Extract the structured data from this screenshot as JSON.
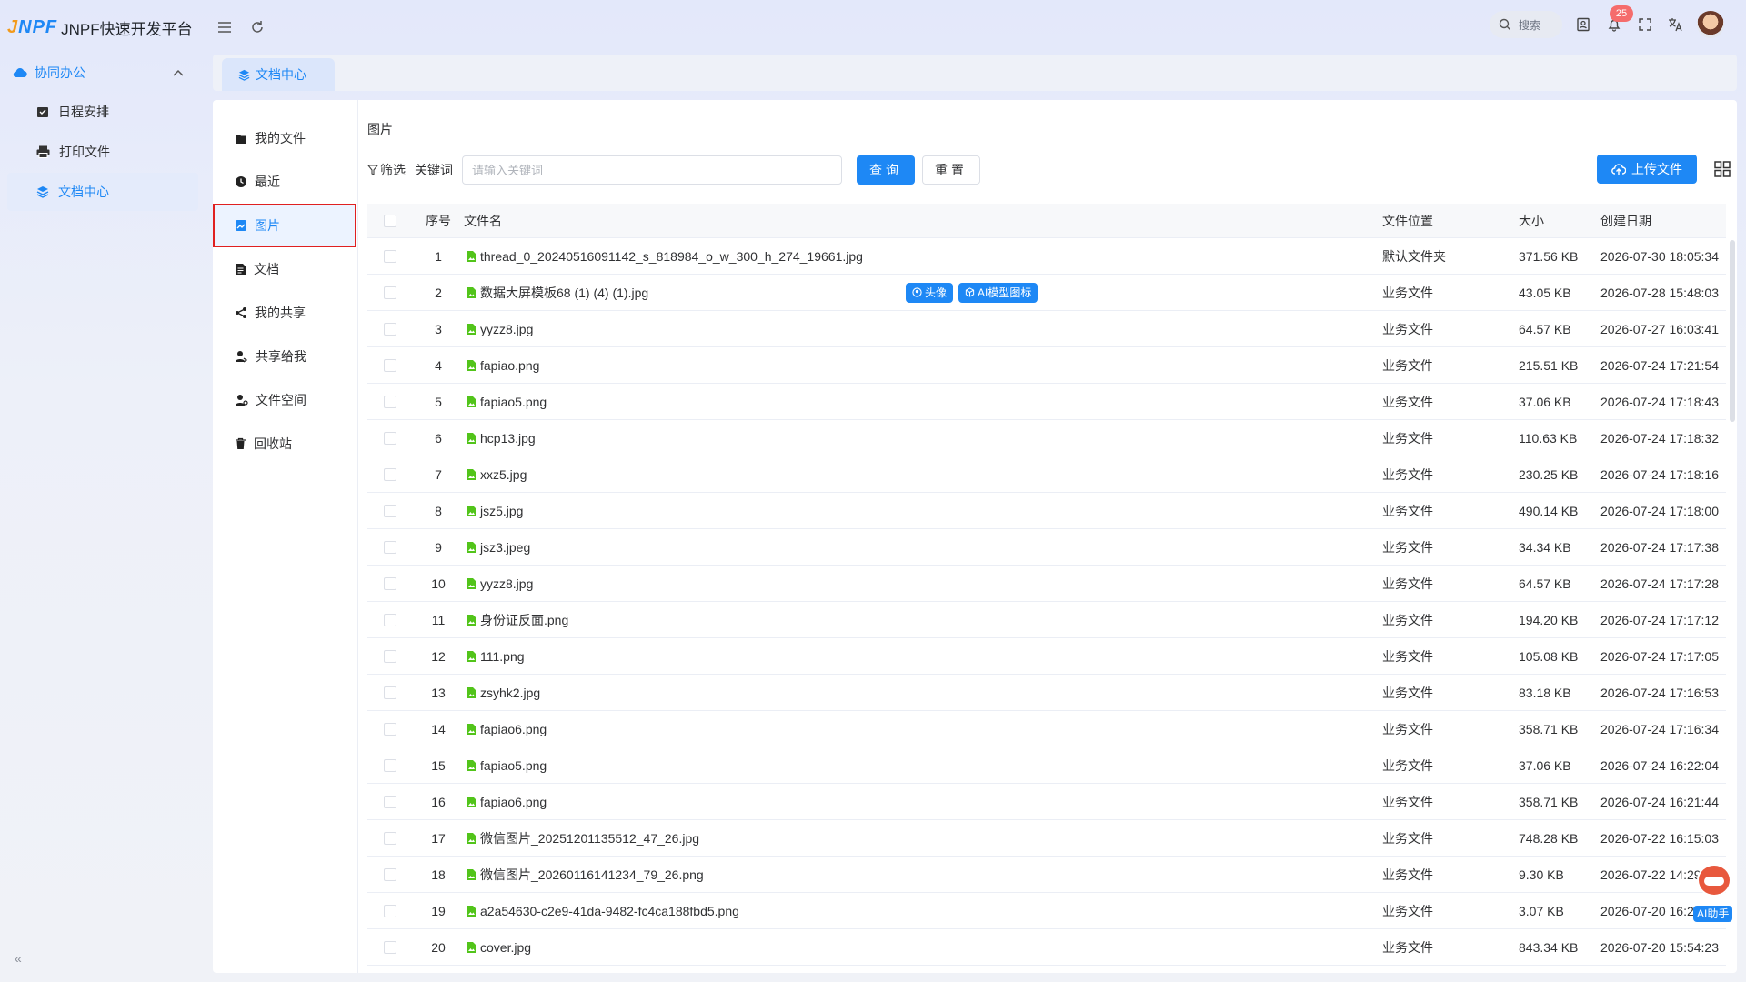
{
  "app": {
    "logo_mark_j": "J",
    "logo_mark_npf": "NPF",
    "title": "JNPF快速开发平台"
  },
  "header": {
    "search_label": "搜索",
    "notification_count": "25"
  },
  "sidebar": {
    "group_label": "协同办公",
    "items": [
      {
        "label": "日程安排"
      },
      {
        "label": "打印文件"
      },
      {
        "label": "文档中心"
      }
    ],
    "active_index": 2
  },
  "tabs": [
    {
      "label": "文档中心"
    }
  ],
  "categories": [
    {
      "label": "我的文件",
      "icon": "folder-icon"
    },
    {
      "label": "最近",
      "icon": "clock-icon"
    },
    {
      "label": "图片",
      "icon": "image-icon"
    },
    {
      "label": "文档",
      "icon": "document-icon"
    },
    {
      "label": "我的共享",
      "icon": "share-icon"
    },
    {
      "label": "共享给我",
      "icon": "shared-user-icon"
    },
    {
      "label": "文件空间",
      "icon": "user-space-icon"
    },
    {
      "label": "回收站",
      "icon": "trash-icon"
    }
  ],
  "active_category": 2,
  "main": {
    "breadcrumb": "图片",
    "filter_label": "筛选",
    "keyword_label": "关键词",
    "keyword_placeholder": "请输入关键词",
    "keyword_value": "",
    "search_button": "查询",
    "reset_button": "重置",
    "upload_button": "上传文件"
  },
  "table": {
    "columns": {
      "index": "序号",
      "name": "文件名",
      "location": "文件位置",
      "size": "大小",
      "created": "创建日期"
    },
    "row_tags": [
      "头像",
      "AI模型图标"
    ],
    "rows": [
      {
        "index": "1",
        "name": "thread_0_20240516091142_s_818984_o_w_300_h_274_19661.jpg",
        "location": "默认文件夹",
        "size": "371.56 KB",
        "created": "2026-07-30 18:05:34"
      },
      {
        "index": "2",
        "name": "数据大屏模板68 (1) (4) (1).jpg",
        "location": "业务文件",
        "size": "43.05 KB",
        "created": "2026-07-28 15:48:03"
      },
      {
        "index": "3",
        "name": "yyzz8.jpg",
        "location": "业务文件",
        "size": "64.57 KB",
        "created": "2026-07-27 16:03:41"
      },
      {
        "index": "4",
        "name": "fapiao.png",
        "location": "业务文件",
        "size": "215.51 KB",
        "created": "2026-07-24 17:21:54"
      },
      {
        "index": "5",
        "name": "fapiao5.png",
        "location": "业务文件",
        "size": "37.06 KB",
        "created": "2026-07-24 17:18:43"
      },
      {
        "index": "6",
        "name": "hcp13.jpg",
        "location": "业务文件",
        "size": "110.63 KB",
        "created": "2026-07-24 17:18:32"
      },
      {
        "index": "7",
        "name": "xxz5.jpg",
        "location": "业务文件",
        "size": "230.25 KB",
        "created": "2026-07-24 17:18:16"
      },
      {
        "index": "8",
        "name": "jsz5.jpg",
        "location": "业务文件",
        "size": "490.14 KB",
        "created": "2026-07-24 17:18:00"
      },
      {
        "index": "9",
        "name": "jsz3.jpeg",
        "location": "业务文件",
        "size": "34.34 KB",
        "created": "2026-07-24 17:17:38"
      },
      {
        "index": "10",
        "name": "yyzz8.jpg",
        "location": "业务文件",
        "size": "64.57 KB",
        "created": "2026-07-24 17:17:28"
      },
      {
        "index": "11",
        "name": "身份证反面.png",
        "location": "业务文件",
        "size": "194.20 KB",
        "created": "2026-07-24 17:17:12"
      },
      {
        "index": "12",
        "name": "111.png",
        "location": "业务文件",
        "size": "105.08 KB",
        "created": "2026-07-24 17:17:05"
      },
      {
        "index": "13",
        "name": "zsyhk2.jpg",
        "location": "业务文件",
        "size": "83.18 KB",
        "created": "2026-07-24 17:16:53"
      },
      {
        "index": "14",
        "name": "fapiao6.png",
        "location": "业务文件",
        "size": "358.71 KB",
        "created": "2026-07-24 17:16:34"
      },
      {
        "index": "15",
        "name": "fapiao5.png",
        "location": "业务文件",
        "size": "37.06 KB",
        "created": "2026-07-24 16:22:04"
      },
      {
        "index": "16",
        "name": "fapiao6.png",
        "location": "业务文件",
        "size": "358.71 KB",
        "created": "2026-07-24 16:21:44"
      },
      {
        "index": "17",
        "name": "微信图片_20251201135512_47_26.jpg",
        "location": "业务文件",
        "size": "748.28 KB",
        "created": "2026-07-22 16:15:03"
      },
      {
        "index": "18",
        "name": "微信图片_20260116141234_79_26.png",
        "location": "业务文件",
        "size": "9.30 KB",
        "created": "2026-07-22 14:29:"
      },
      {
        "index": "19",
        "name": "a2a54630-c2e9-41da-9482-fc4ca188fbd5.png",
        "location": "业务文件",
        "size": "3.07 KB",
        "created": "2026-07-20 16:28"
      },
      {
        "index": "20",
        "name": "cover.jpg",
        "location": "业务文件",
        "size": "843.34 KB",
        "created": "2026-07-20 15:54:23"
      }
    ]
  },
  "ai_helper": {
    "label": "AI助手"
  },
  "colors": {
    "primary": "#1e88f5",
    "highlight": "#e02020",
    "file_icon": "#52c41a"
  }
}
